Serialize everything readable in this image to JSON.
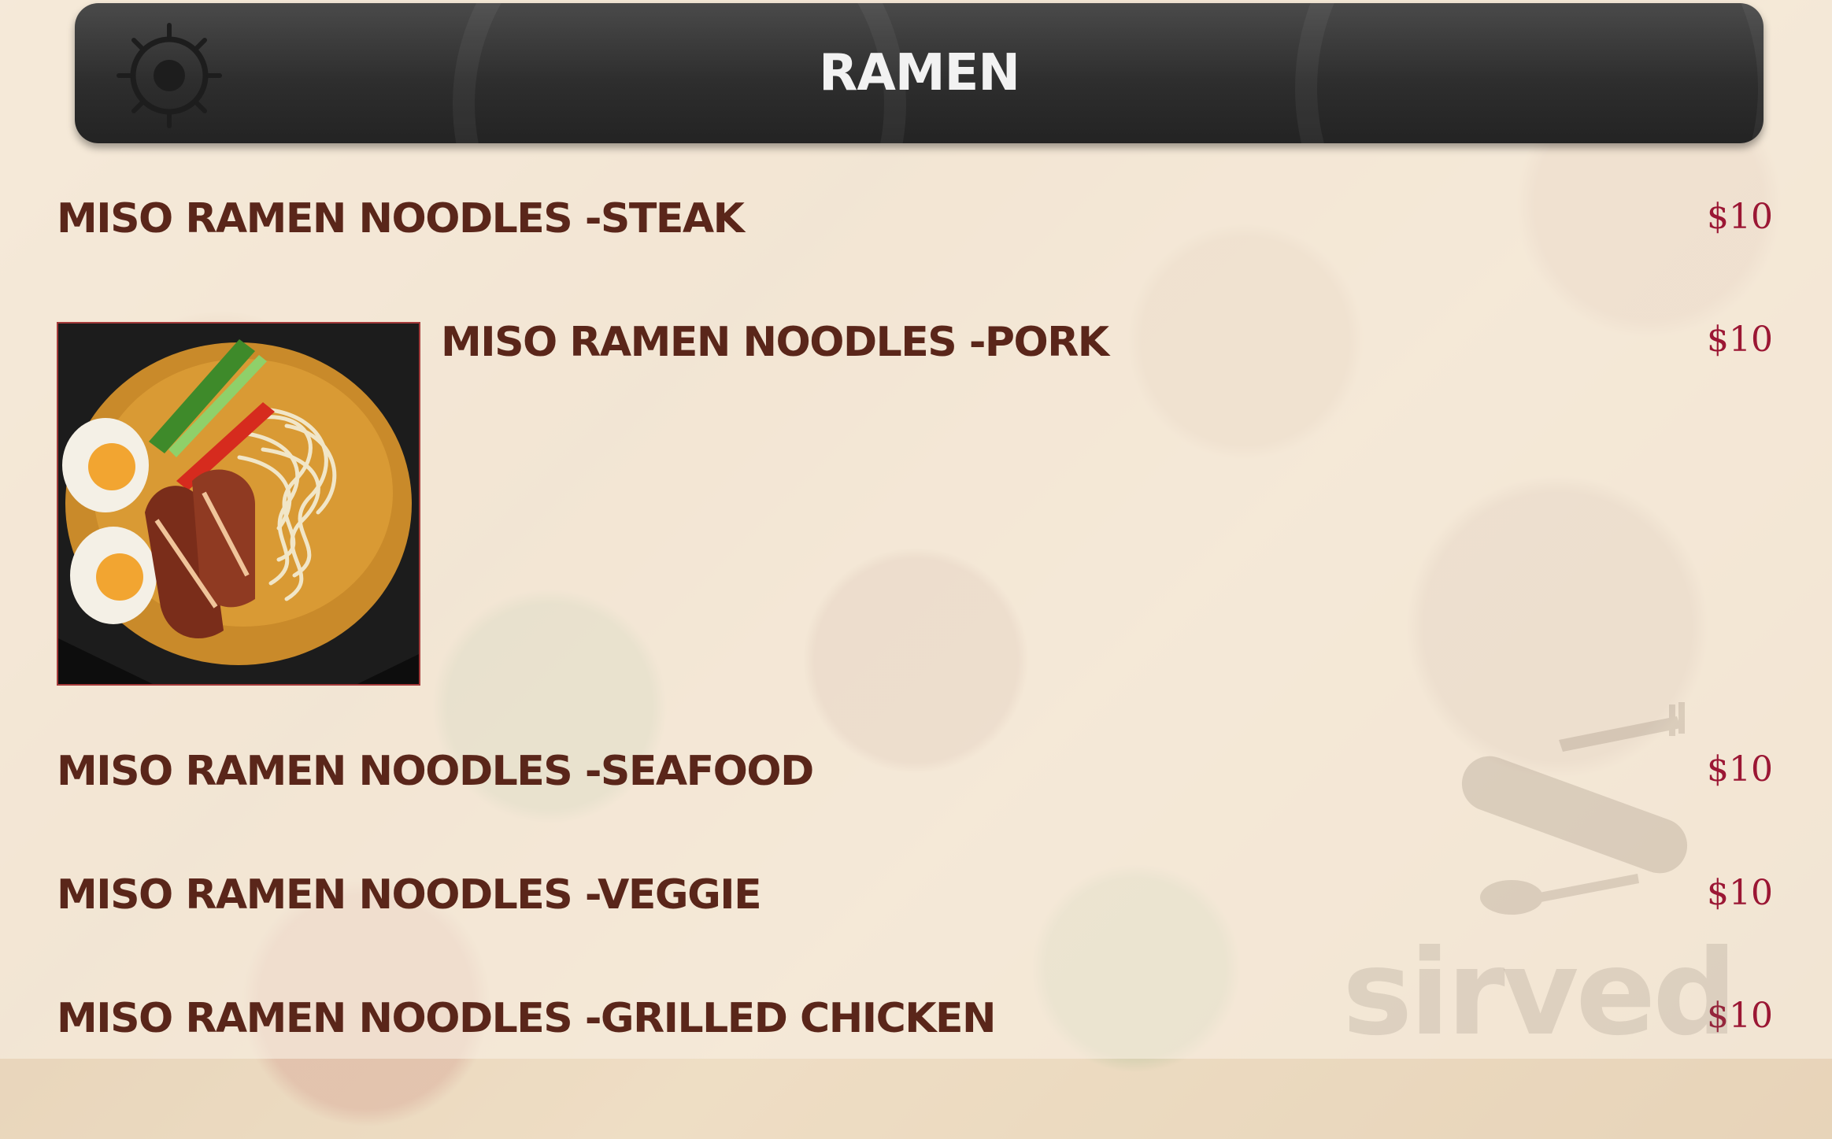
{
  "header": {
    "title": "RAMEN"
  },
  "menu": {
    "items": [
      {
        "name": "MISO RAMEN NOODLES -STEAK",
        "price": "$10"
      },
      {
        "name": "MISO RAMEN NOODLES -PORK",
        "price": "$10"
      },
      {
        "name": "MISO RAMEN NOODLES -SEAFOOD",
        "price": "$10"
      },
      {
        "name": "MISO RAMEN NOODLES -VEGGIE",
        "price": "$10"
      },
      {
        "name": "MISO RAMEN NOODLES -GRILLED CHICKEN",
        "price": "$10"
      }
    ]
  },
  "watermark": {
    "text": "sirved"
  },
  "colors": {
    "header_bg": "#2e2e2e",
    "header_text": "#f2f2f2",
    "item_name": "#5a261a",
    "price": "#9b1734"
  },
  "icons": {
    "header_logo": "sun-ring-logo-icon",
    "photo": "ramen-bowl-photo",
    "cutlery": "cutlery-board-icon"
  }
}
